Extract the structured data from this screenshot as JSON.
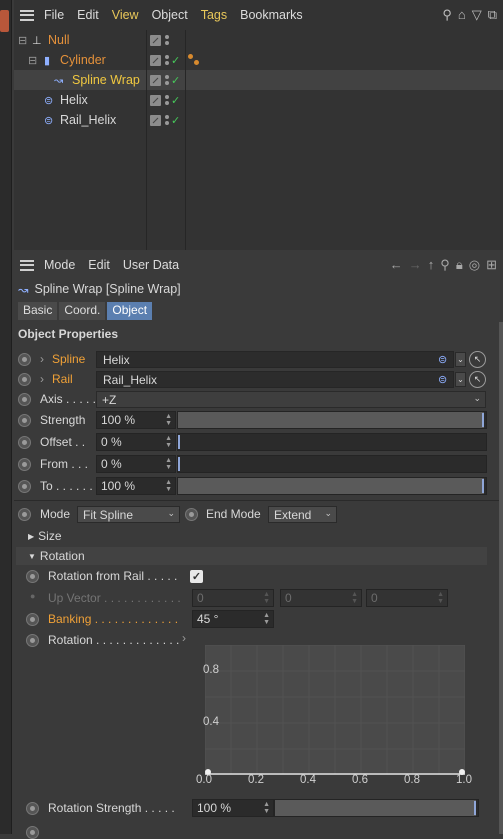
{
  "object_manager": {
    "menu": [
      "File",
      "Edit",
      "View",
      "Object",
      "Tags",
      "Bookmarks"
    ],
    "menu_highlight": [
      "View",
      "Tags"
    ],
    "tools": [
      "search-icon",
      "home-icon",
      "filter-icon",
      "layers-icon"
    ],
    "tree": [
      {
        "label": "Null",
        "depth": 0,
        "color": "#f0a137",
        "icon": "null-icon"
      },
      {
        "label": "Cylinder",
        "depth": 1,
        "color": "#f0a137",
        "icon": "cylinder-icon"
      },
      {
        "label": "Spline Wrap",
        "depth": 2,
        "color": "#f0c840",
        "icon": "spline-wrap-icon",
        "selected": true
      },
      {
        "label": "Helix",
        "depth": 1,
        "color": "#d8d8d8",
        "icon": "spline-icon"
      },
      {
        "label": "Rail_Helix",
        "depth": 1,
        "color": "#d8d8d8",
        "icon": "spline-icon"
      }
    ]
  },
  "attribute_manager": {
    "menu": [
      "Mode",
      "Edit",
      "User Data"
    ],
    "tools": [
      "back-arrow-icon",
      "forward-arrow-icon",
      "up-arrow-icon",
      "search-icon",
      "lock-icon",
      "target-icon",
      "new-panel-icon"
    ],
    "object_title": "Spline Wrap [Spline Wrap]",
    "tabs": [
      "Basic",
      "Coord.",
      "Object"
    ],
    "active_tab": "Object",
    "section": "Object Properties",
    "spline": {
      "label": "Spline",
      "value": "Helix"
    },
    "rail": {
      "label": "Rail",
      "value": "Rail_Helix"
    },
    "axis": {
      "label": "Axis . . . . .",
      "value": "+Z"
    },
    "strength": {
      "label": "Strength",
      "value": "100 %",
      "level": 1.0
    },
    "offset": {
      "label": "Offset . .",
      "value": "0 %",
      "level": 0.0
    },
    "from": {
      "label": "From . . .",
      "value": "0 %",
      "level": 0.0
    },
    "to": {
      "label": "To . . . . . .",
      "value": "100 %",
      "level": 1.0
    },
    "mode": {
      "label": "Mode",
      "value": "Fit Spline"
    },
    "end_mode": {
      "label": "End Mode",
      "value": "Extend"
    },
    "group_size": "Size",
    "group_rotation": "Rotation",
    "rotation_from_rail": {
      "label": "Rotation from Rail . . . . .",
      "checked": true
    },
    "up_vector": {
      "label": "Up Vector . . . . . . . . . . . .",
      "values": [
        "0",
        "0",
        "0"
      ]
    },
    "banking": {
      "label": "Banking . . . . . . . . . . . . .",
      "value": "45 °"
    },
    "rotation_curve": {
      "label": "Rotation . . . . . . . . . . . . ."
    },
    "rotation_strength": {
      "label": "Rotation Strength . . . . .",
      "value": "100 %",
      "level": 1.0
    }
  },
  "chart_data": {
    "type": "line",
    "x": [
      0.0,
      1.0
    ],
    "y": [
      0.0,
      0.0
    ],
    "xticks": [
      "0.0",
      "0.2",
      "0.4",
      "0.6",
      "0.8",
      "1.0"
    ],
    "yticks": [
      "0.4",
      "0.8"
    ],
    "xlim": [
      0,
      1
    ],
    "ylim": [
      0,
      1
    ],
    "grid": true
  }
}
